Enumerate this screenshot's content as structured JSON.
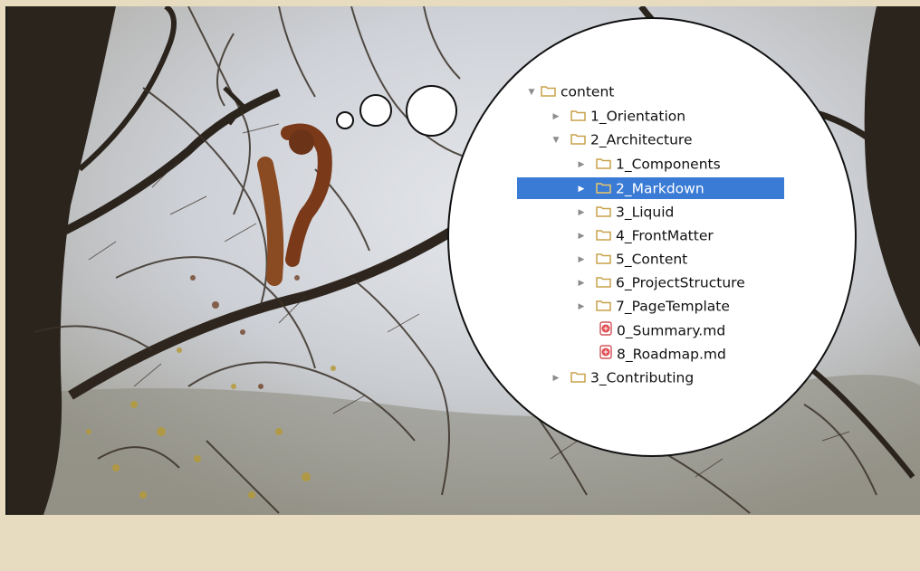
{
  "file_tree": {
    "root": {
      "label": "content",
      "expanded": true,
      "icon": "folder-icon"
    },
    "items": [
      {
        "label": "1_Orientation",
        "type": "folder",
        "expanded": false
      },
      {
        "label": "2_Architecture",
        "type": "folder",
        "expanded": true
      },
      {
        "label": "1_Components",
        "type": "folder",
        "expanded": false
      },
      {
        "label": "2_Markdown",
        "type": "folder",
        "expanded": false,
        "selected": true
      },
      {
        "label": "3_Liquid",
        "type": "folder",
        "expanded": false
      },
      {
        "label": "4_FrontMatter",
        "type": "folder",
        "expanded": false
      },
      {
        "label": "5_Content",
        "type": "folder",
        "expanded": false
      },
      {
        "label": "6_ProjectStructure",
        "type": "folder",
        "expanded": false
      },
      {
        "label": "7_PageTemplate",
        "type": "folder",
        "expanded": false
      },
      {
        "label": "0_Summary.md",
        "type": "file",
        "icon": "markdown-file-icon"
      },
      {
        "label": "8_Roadmap.md",
        "type": "file",
        "icon": "markdown-file-icon"
      },
      {
        "label": "3_Contributing",
        "type": "folder",
        "expanded": false
      }
    ]
  },
  "colors": {
    "selection": "#3a7bd5",
    "folder": "#c8a24a",
    "page_background": "#e8dcc0"
  }
}
